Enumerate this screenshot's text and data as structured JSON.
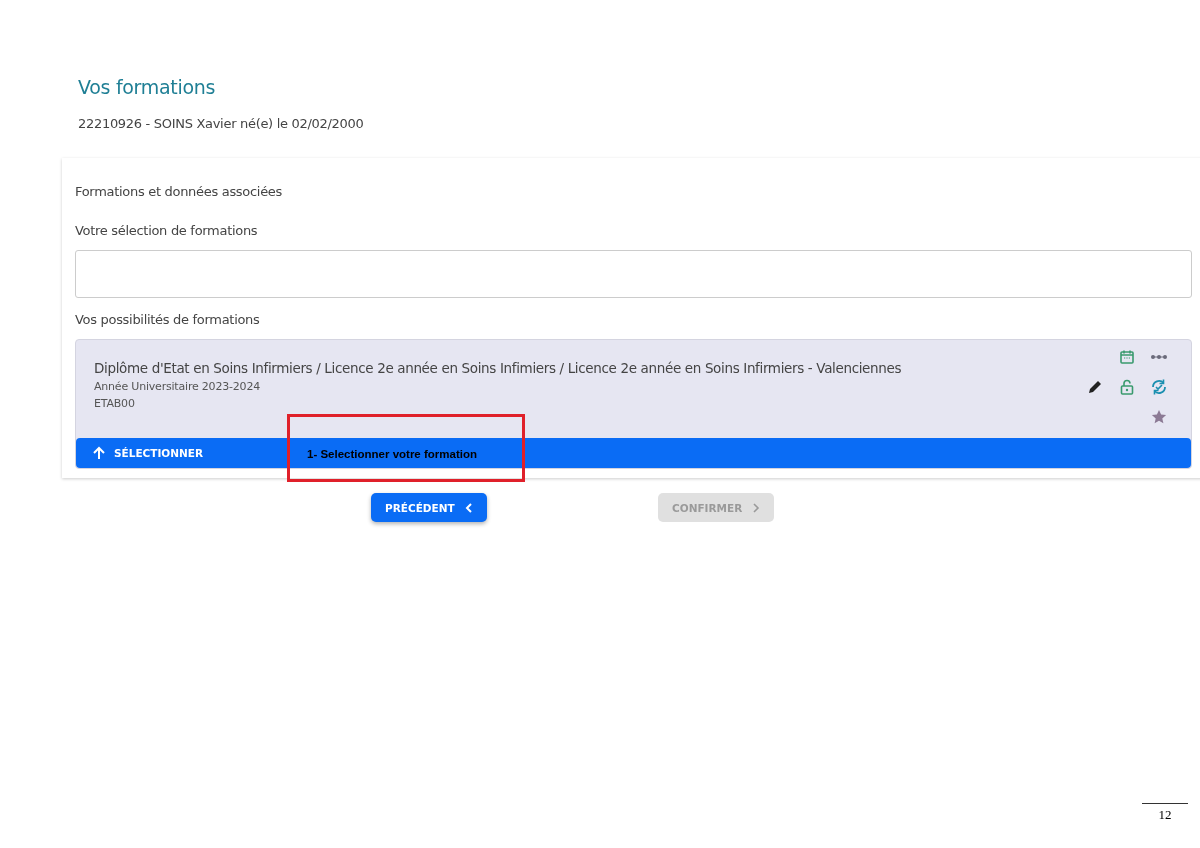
{
  "page": {
    "title": "Vos formations",
    "student": "22210926 - SOINS Xavier né(e) le 02/02/2000",
    "page_number": "12"
  },
  "card": {
    "heading": "Formations et données associées",
    "selection_label": "Votre sélection de formations",
    "possibilities_label": "Vos possibilités de formations"
  },
  "formations": [
    {
      "title": "Diplôme d'Etat en Soins Infirmiers / Licence 2e année en Soins Infimiers / Licence 2e année en Soins Infirmiers - Valenciennes",
      "year": "Année Universitaire 2023-2024",
      "code": "ETAB00",
      "select_label": "SÉLECTIONNER"
    }
  ],
  "annotation": {
    "text": "1- Selectionner votre formation"
  },
  "buttons": [
    {
      "label": "PRÉCÉDENT",
      "disabled": false
    },
    {
      "label": "CONFIRMER",
      "disabled": true
    }
  ]
}
